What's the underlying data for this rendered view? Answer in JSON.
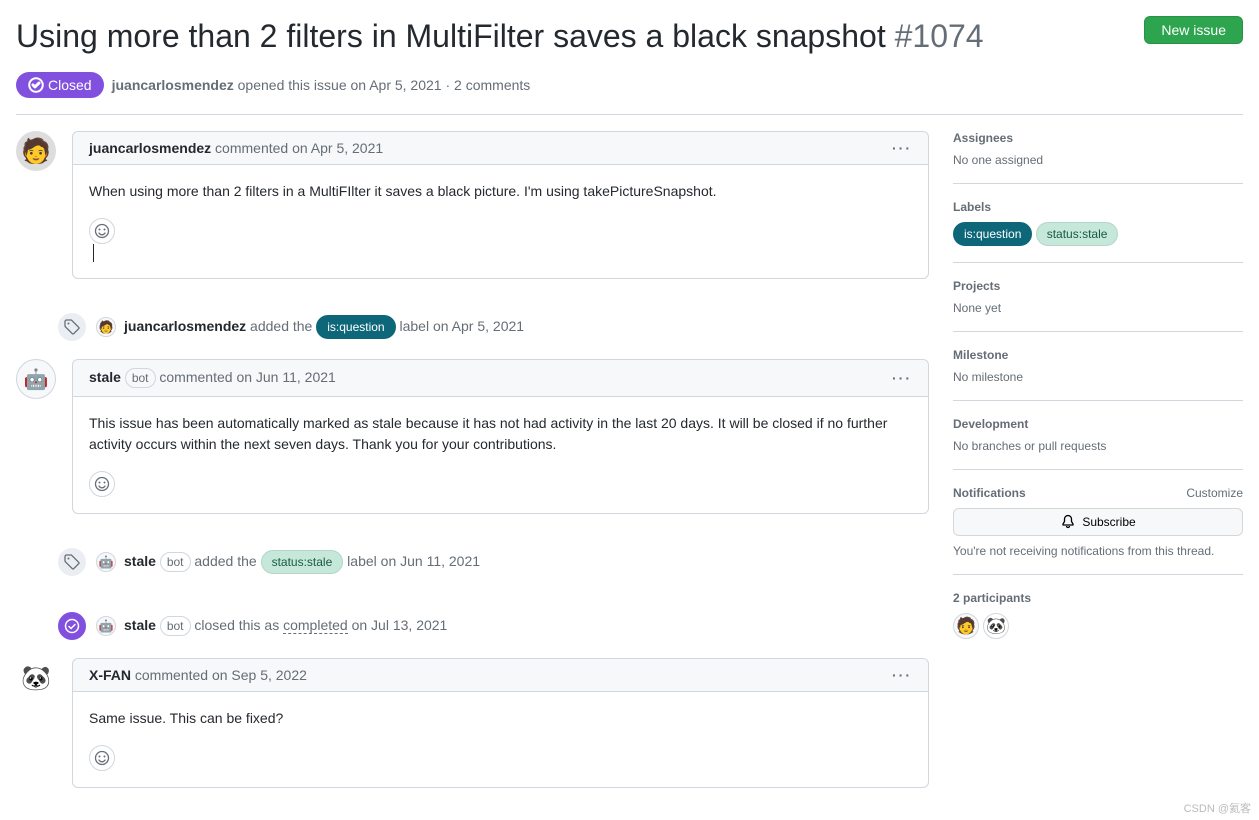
{
  "issue": {
    "title": "Using more than 2 filters in MultiFilter saves a black snapshot",
    "number": "#1074",
    "state": "Closed",
    "author": "juancarlosmendez",
    "opened_text": "opened this issue",
    "date": "on Apr 5, 2021",
    "comment_count": "2 comments"
  },
  "new_issue_button": "New issue",
  "comments": [
    {
      "author": "juancarlosmendez",
      "avatar_emoji": "🧑",
      "is_bot": false,
      "verb": "commented",
      "date": "on Apr 5, 2021",
      "body": "When using more than 2 filters in a MultiFIlter it saves a black picture. I'm using takePictureSnapshot.",
      "show_cursor": true
    },
    {
      "author": "stale",
      "avatar_emoji": "🤖",
      "is_bot": true,
      "verb": "commented",
      "date": "on Jun 11, 2021",
      "body": "This issue has been automatically marked as stale because it has not had activity in the last 20 days. It will be closed if no further activity occurs within the next seven days. Thank you for your contributions."
    },
    {
      "author": "X-FAN",
      "avatar_emoji": "🐼",
      "is_bot": false,
      "verb": "commented",
      "date": "on Sep 5, 2022",
      "body": "Same issue. This can be fixed?"
    }
  ],
  "events": [
    {
      "actor": "juancarlosmendez",
      "avatar_emoji": "🧑",
      "is_bot": false,
      "action": "added the",
      "label": "is:question",
      "label_class": "label-question",
      "suffix": "label",
      "date": "on Apr 5, 2021",
      "badge_icon": "tag"
    },
    {
      "actor": "stale",
      "avatar_emoji": "🤖",
      "is_bot": true,
      "action": "added the",
      "label": "status:stale",
      "label_class": "label-stale",
      "suffix": "label",
      "date": "on Jun 11, 2021",
      "badge_icon": "tag"
    },
    {
      "actor": "stale",
      "avatar_emoji": "🤖",
      "is_bot": true,
      "action": "closed this as",
      "closed_as": "completed",
      "date": "on Jul 13, 2021",
      "badge_icon": "closed"
    }
  ],
  "bot_label": "bot",
  "sidebar": {
    "assignees": {
      "heading": "Assignees",
      "value": "No one assigned"
    },
    "labels": {
      "heading": "Labels",
      "items": [
        {
          "text": "is:question",
          "class": "label-question"
        },
        {
          "text": "status:stale",
          "class": "label-stale"
        }
      ]
    },
    "projects": {
      "heading": "Projects",
      "value": "None yet"
    },
    "milestone": {
      "heading": "Milestone",
      "value": "No milestone"
    },
    "development": {
      "heading": "Development",
      "value": "No branches or pull requests"
    },
    "notifications": {
      "heading": "Notifications",
      "customize": "Customize",
      "subscribe": "Subscribe",
      "note": "You're not receiving notifications from this thread."
    },
    "participants": {
      "heading": "2 participants"
    }
  },
  "watermark": "CSDN @氦客"
}
